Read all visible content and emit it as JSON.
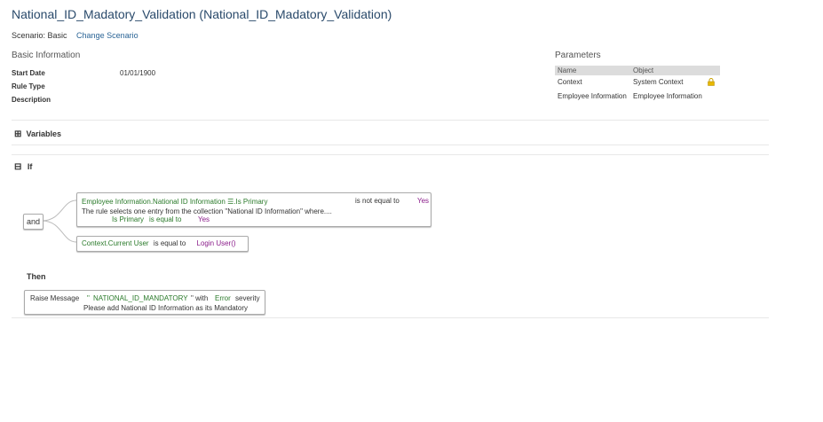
{
  "page": {
    "title": "National_ID_Madatory_Validation (National_ID_Madatory_Validation)",
    "scenario_label": "Scenario: Basic",
    "change_scenario": "Change Scenario"
  },
  "basic_info": {
    "heading": "Basic Information",
    "start_date_label": "Start Date",
    "start_date_value": "01/01/1900",
    "rule_type_label": "Rule Type",
    "description_label": "Description"
  },
  "parameters": {
    "heading": "Parameters",
    "col_name": "Name",
    "col_object": "Object",
    "rows": [
      {
        "name": "Context",
        "object": "System Context"
      },
      {
        "name": "Employee Information",
        "object": "Employee Information"
      }
    ]
  },
  "variables": {
    "label": "Variables",
    "expand_glyph": "⊞"
  },
  "if_block": {
    "label": "If",
    "collapse_glyph": "⊟",
    "operator": "and",
    "cond1": {
      "field": "Employee Information.National ID Information ☰.Is Primary",
      "operator": "is not equal to",
      "value": "Yes",
      "note": "The rule selects one entry from the collection \"National ID Information\" where....",
      "sub_field": "Is Primary",
      "sub_operator": "is equal to",
      "sub_value": "Yes"
    },
    "cond2": {
      "field": "Context.Current User",
      "operator": "is equal to",
      "value": "Login User()"
    }
  },
  "then_block": {
    "label": "Then",
    "action": "Raise Message",
    "message_prefix": "\"",
    "message_code": "NATIONAL_ID_MANDATORY",
    "message_suffix": "\" with",
    "severity": "Error",
    "severity_label": "severity",
    "message_text": "Please add National ID Information as its Mandatory"
  },
  "colors": {
    "title": "#2a4a6b",
    "link": "#2a6496",
    "field": "#2a7a2a",
    "value": "#8a1c8a"
  }
}
